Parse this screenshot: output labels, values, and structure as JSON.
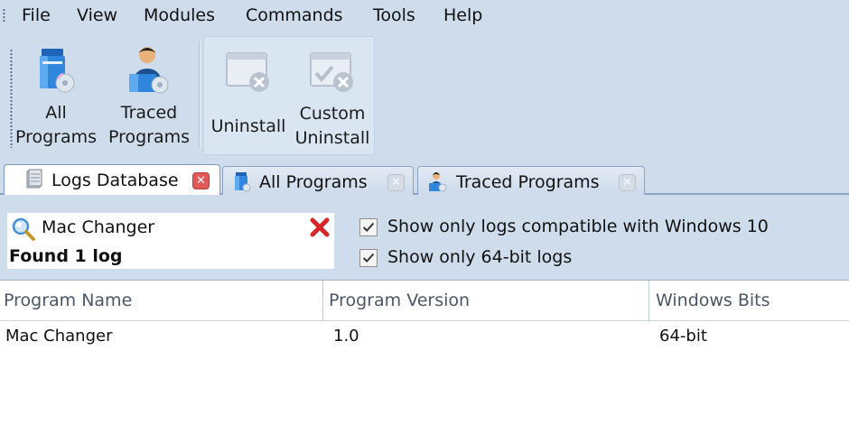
{
  "menu": {
    "items": [
      "File",
      "View",
      "Modules",
      "Commands",
      "Tools",
      "Help"
    ]
  },
  "toolbar": {
    "all_programs": "All\nPrograms",
    "traced_programs": "Traced\nPrograms",
    "uninstall": "Uninstall",
    "custom_uninstall": "Custom\nUninstall"
  },
  "tabs": [
    {
      "label": "Logs Database",
      "icon": "database-icon",
      "active": true
    },
    {
      "label": "All Programs",
      "icon": "programs-icon",
      "active": false
    },
    {
      "label": "Traced Programs",
      "icon": "user-icon",
      "active": false
    }
  ],
  "search": {
    "value": "Mac Changer",
    "status": "Found 1 log"
  },
  "filters": {
    "win10_label": "Show only logs compatible with Windows 10",
    "win10_checked": true,
    "bits64_label": "Show only 64-bit logs",
    "bits64_checked": true
  },
  "table": {
    "columns": [
      "Program Name",
      "Program Version",
      "Windows Bits"
    ],
    "rows": [
      {
        "name": "Mac Changer",
        "version": "1.0",
        "bits": "64-bit"
      }
    ]
  },
  "colors": {
    "chrome": "#cfdcec",
    "close_active": "#e05a5a",
    "accent_blue": "#2f7fd0"
  }
}
